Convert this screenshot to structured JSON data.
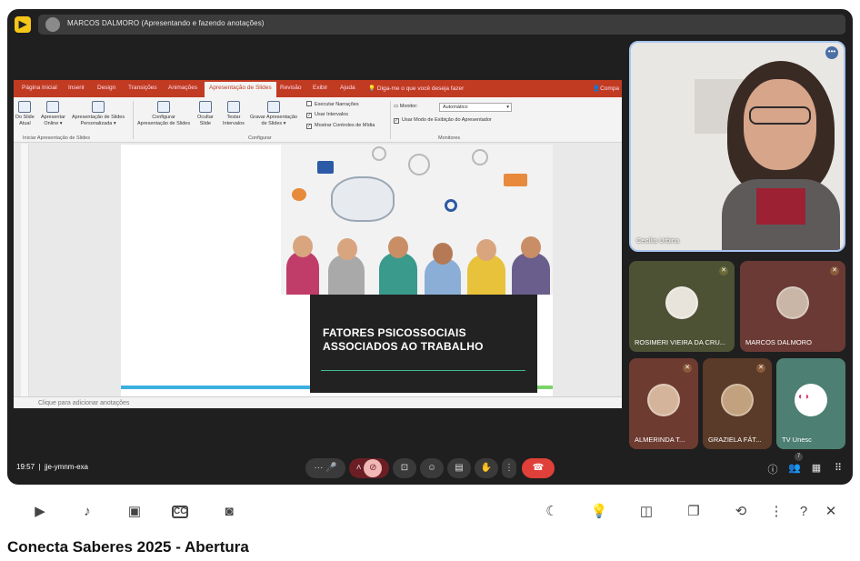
{
  "meeting": {
    "presenting_banner": "MARCOS DALMORO (Apresentando e fazendo anotações)",
    "clock": "19:57",
    "meeting_code": "jje-ymnm-exa",
    "people_count": "7"
  },
  "powerpoint": {
    "tabs": [
      "Página Inicial",
      "Inserir",
      "Design",
      "Transições",
      "Animações",
      "Apresentação de Slides",
      "Revisão",
      "Exibir",
      "Ajuda"
    ],
    "tellme": "Diga-me o que você deseja fazer",
    "share": "Compa",
    "ribbon": {
      "from_current": "Do Slide\nAtual",
      "present_online": "Apresentar\nOnline ▾",
      "custom_show": "Apresentação de Slides\nPersonalizada ▾",
      "setup_show": "Configurar\nApresentação de Slides",
      "hide_slide": "Ocultar\nSlide",
      "rehearse": "Testar\nIntervalos",
      "record": "Gravar Apresentação\nde Slides ▾",
      "group_start": "Iniciar Apresentação de Slides",
      "group_setup": "Configurar",
      "group_monitors": "Monitores",
      "chk_narrations": "Executar Narrações",
      "chk_timings": "Usar Intervalos",
      "chk_media": "Mostrar Controles de Mídia",
      "monitor_label": "Monitor:",
      "monitor_value": "Automático",
      "chk_presenter": "Usar Modo de Exibição do Apresentador"
    },
    "slide_title_line1": "FATORES PSICOSSOCIAIS",
    "slide_title_line2": "ASSOCIADOS AO TRABALHO",
    "notes_placeholder": "Clique para adicionar anotações"
  },
  "participants": {
    "main": {
      "name": "Cecília Urbina"
    },
    "tiles": [
      {
        "name": "ROSIMERI VIEIRA DA CRU...",
        "bg": "#4e5235"
      },
      {
        "name": "MARCOS DALMORO",
        "bg": "#6b3a34"
      },
      {
        "name": "ALMERINDA T...",
        "bg": "#6e3b30"
      },
      {
        "name": "GRAZIELA FÁT...",
        "bg": "#5a3a28"
      },
      {
        "name": "TV Unesc",
        "bg": "#4d7f72"
      }
    ]
  },
  "player": {
    "video_title": "Conecta Saberes 2025 - Abertura"
  },
  "colors": {
    "ribbon_red": "#c13b22",
    "end_call_red": "#e0403a"
  }
}
